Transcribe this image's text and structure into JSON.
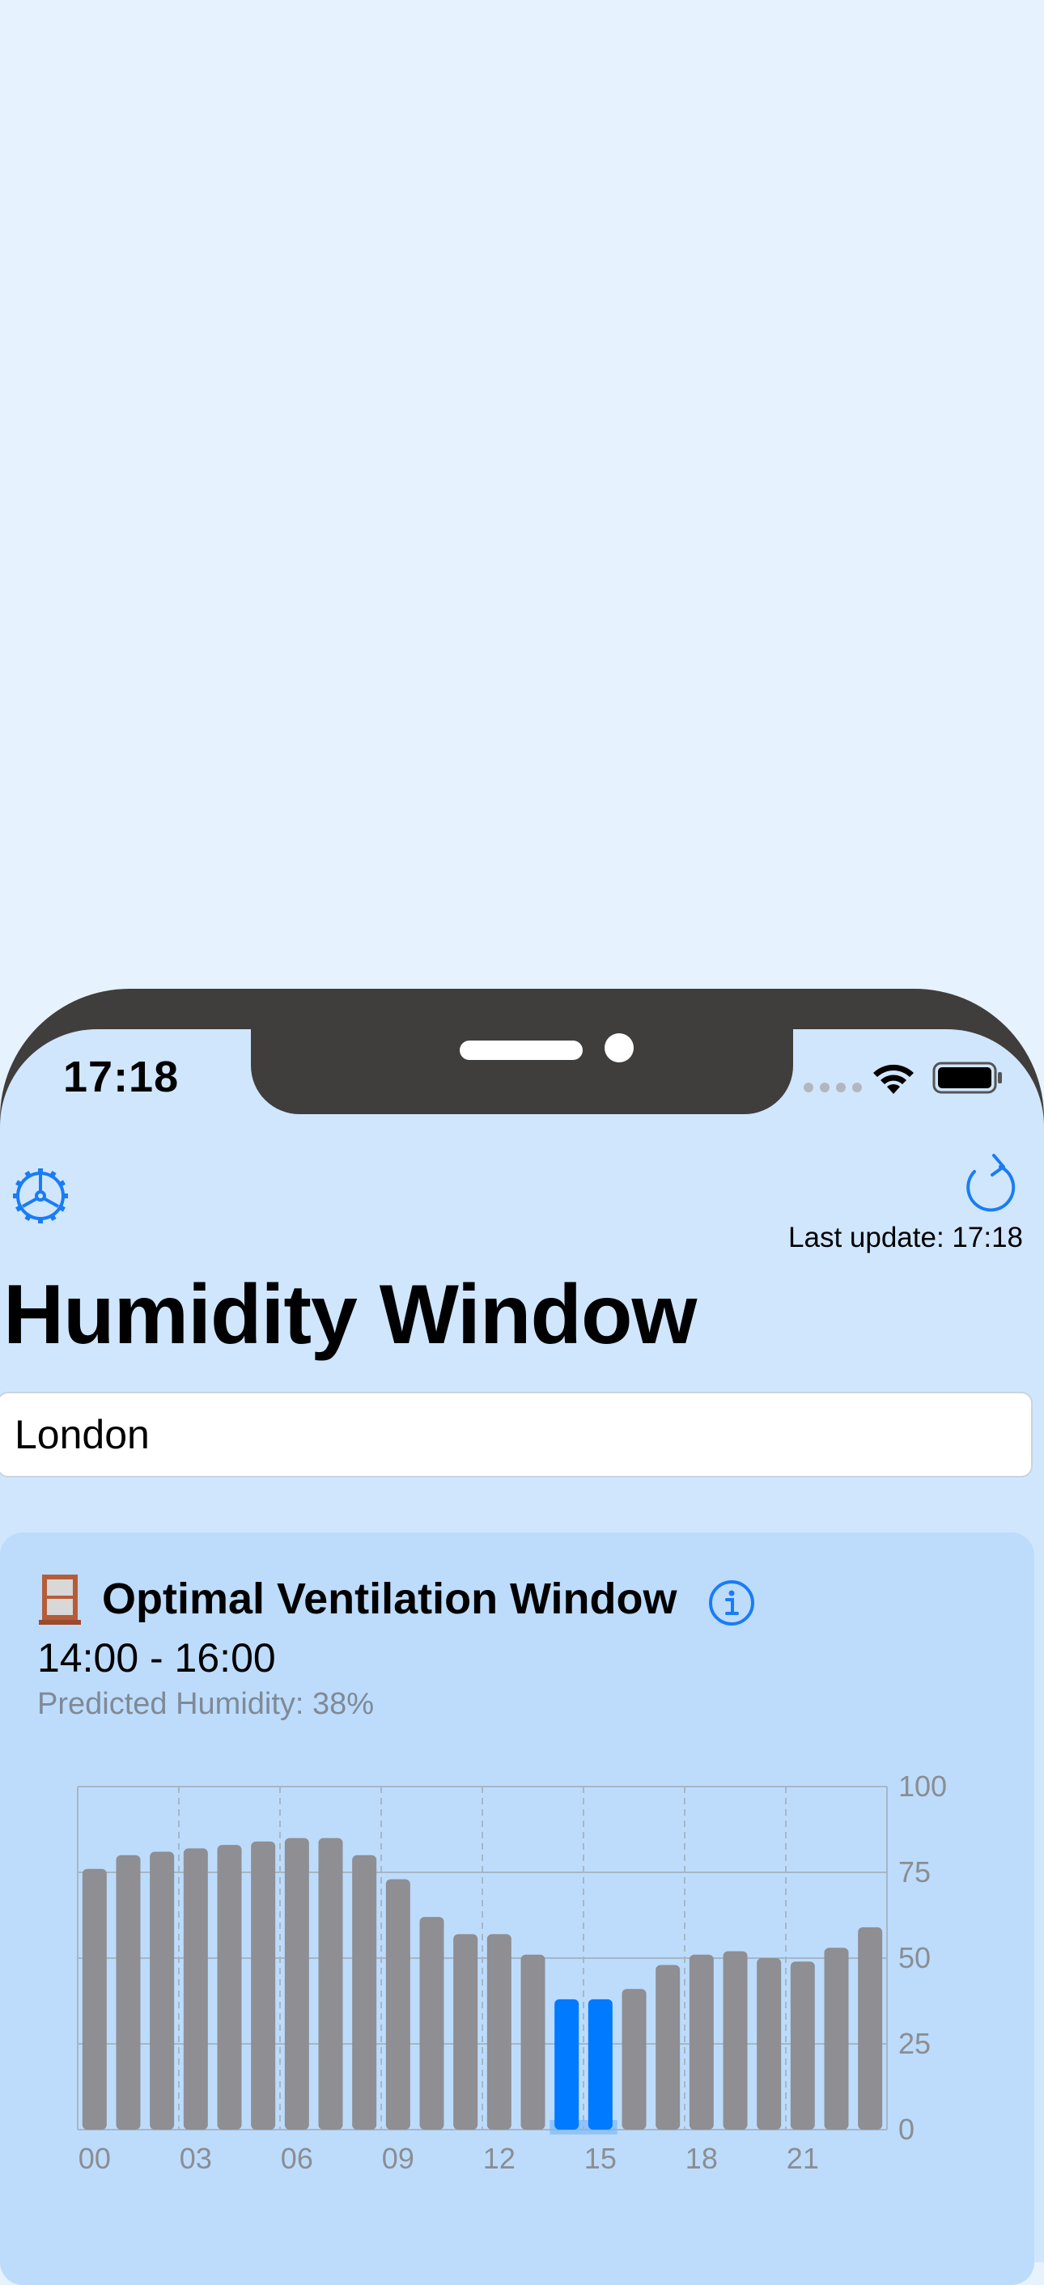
{
  "status_bar": {
    "time": "17:18"
  },
  "toolbar": {
    "settings_icon": "gear-icon",
    "refresh_icon": "refresh-icon"
  },
  "header": {
    "last_update": "Last update: 17:18",
    "title": "Humidity Window"
  },
  "location": {
    "value": "London"
  },
  "card": {
    "icon": "window-icon",
    "title": "Optimal Ventilation Window",
    "info_icon": "info-icon",
    "time_range": "14:00 - 16:00",
    "predicted": "Predicted Humidity: 38%"
  },
  "colors": {
    "accent": "#1a7cf5",
    "bar": "#8e8e93",
    "highlight": "#007aff"
  },
  "chart_data": {
    "type": "bar",
    "categories": [
      "00",
      "01",
      "02",
      "03",
      "04",
      "05",
      "06",
      "07",
      "08",
      "09",
      "10",
      "11",
      "12",
      "13",
      "14",
      "15",
      "16",
      "17",
      "18",
      "19",
      "20",
      "21",
      "22",
      "23"
    ],
    "values": [
      76,
      80,
      81,
      82,
      83,
      84,
      85,
      85,
      80,
      73,
      62,
      57,
      57,
      51,
      38,
      38,
      41,
      48,
      51,
      52,
      50,
      49,
      53,
      59
    ],
    "highlight": [
      "14",
      "15"
    ],
    "x_tick_labels": [
      "00",
      "03",
      "06",
      "09",
      "12",
      "15",
      "18",
      "21"
    ],
    "y_tick_labels": [
      "100",
      "75",
      "50",
      "25",
      "0"
    ],
    "ylim": [
      0,
      100
    ],
    "grid": true
  }
}
